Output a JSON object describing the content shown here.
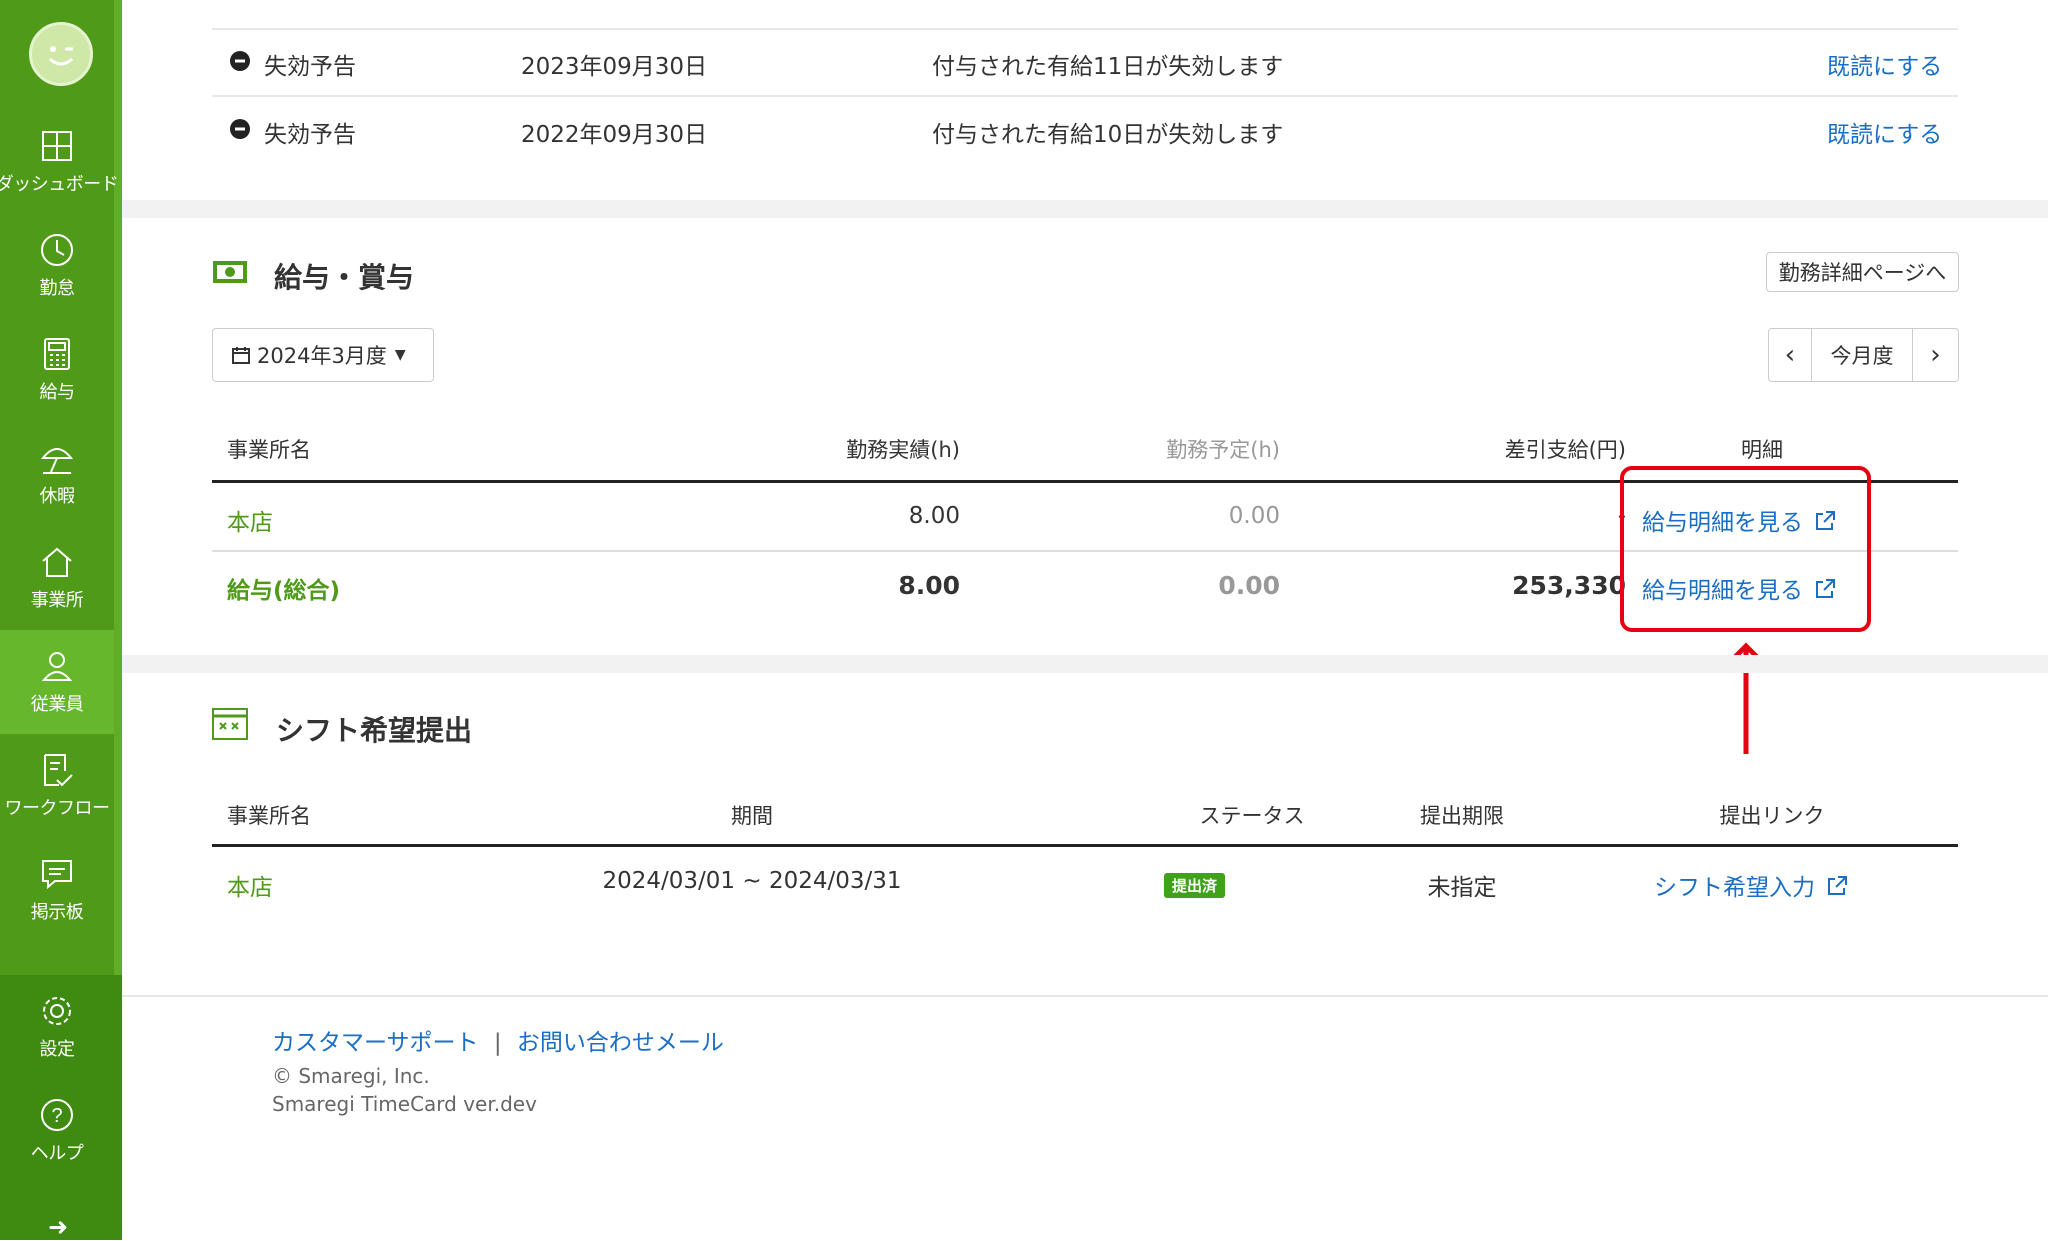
{
  "sidebar": {
    "items": [
      {
        "label": "ダッシュボード",
        "icon": "dashboard-icon"
      },
      {
        "label": "勤怠",
        "icon": "clock-icon"
      },
      {
        "label": "給与",
        "icon": "calculator-icon"
      },
      {
        "label": "休暇",
        "icon": "umbrella-icon"
      },
      {
        "label": "事業所",
        "icon": "home-icon"
      },
      {
        "label": "従業員",
        "icon": "person-icon"
      },
      {
        "label": "ワークフロー",
        "icon": "workflow-icon"
      },
      {
        "label": "掲示板",
        "icon": "board-icon"
      },
      {
        "label": "設定",
        "icon": "gear-icon"
      },
      {
        "label": "ヘルプ",
        "icon": "help-icon"
      }
    ],
    "active": "従業員"
  },
  "notices": {
    "rows": [
      {
        "type": "失効予告",
        "date": "2023年09月30日",
        "message": "付与された有給11日が失効します",
        "action": "既読にする"
      },
      {
        "type": "失効予告",
        "date": "2022年09月30日",
        "message": "付与された有給10日が失効します",
        "action": "既読にする"
      }
    ]
  },
  "salary": {
    "title": "給与・賞与",
    "detail_button": "勤務詳細ページへ",
    "month_select": "2024年3月度",
    "current_month_button": "今月度",
    "prev": "‹",
    "next": "›",
    "headers": [
      "事業所名",
      "勤務実績(h)",
      "勤務予定(h)",
      "差引支給(円)",
      "明細"
    ],
    "rows": [
      {
        "office": "本店",
        "actual": "8.00",
        "planned": "0.00",
        "net": "-",
        "link": "給与明細を見る"
      },
      {
        "office": "給与(総合)",
        "actual": "8.00",
        "planned": "0.00",
        "net": "253,330",
        "link": "給与明細を見る"
      }
    ]
  },
  "shift": {
    "title": "シフト希望提出",
    "headers": [
      "事業所名",
      "期間",
      "ステータス",
      "提出期限",
      "提出リンク"
    ],
    "rows": [
      {
        "office": "本店",
        "period": "2024/03/01 ~ 2024/03/31",
        "status": "提出済",
        "deadline": "未指定",
        "link": "シフト希望入力"
      }
    ]
  },
  "footer": {
    "support": "カスタマーサポート",
    "separator": "|",
    "mail": "お問い合わせメール",
    "copyright": "© Smaregi, Inc.",
    "version": "Smaregi TimeCard ver.dev"
  },
  "colors": {
    "brand": "#4f9a19",
    "link": "#1a6fc4",
    "highlight": "#e60012"
  }
}
